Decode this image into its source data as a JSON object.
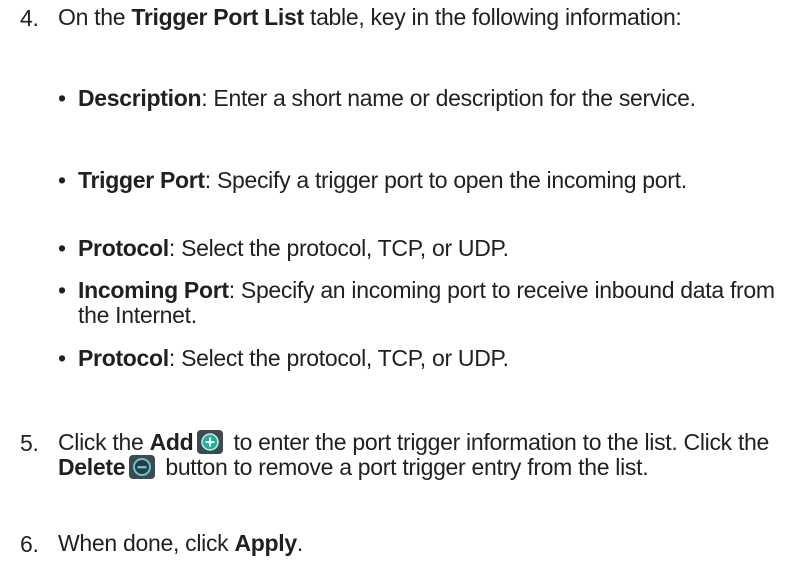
{
  "steps": [
    {
      "number": "4.",
      "prefix": "On the ",
      "bold": "Trigger Port List",
      "suffix": " table, key in the following information:"
    },
    {
      "number": "5.",
      "text_a": "Click the ",
      "bold_a": "Add",
      "text_b": " to enter the port trigger information to the list. Click the ",
      "bold_b": "Delete",
      "text_c": " button to remove a port trigger entry from the list."
    },
    {
      "number": "6.",
      "prefix": "When done, click ",
      "bold": "Apply",
      "suffix": "."
    }
  ],
  "bullets": [
    {
      "term": "Description",
      "text": ": Enter a short name or description for the service."
    },
    {
      "term": "Trigger Port",
      "text": ": Specify a trigger port to open the incoming port."
    },
    {
      "term": "Protocol",
      "text": ": Select the protocol, TCP, or UDP."
    },
    {
      "term": "Incoming Port",
      "text": ": Specify an incoming port to receive inbound data from the Internet."
    },
    {
      "term": "Protocol",
      "text": ": Select the protocol, TCP, or UDP."
    }
  ],
  "bullet_glyph": "•",
  "icons": {
    "add": "add-circle-icon",
    "delete": "delete-circle-icon"
  },
  "colors": {
    "text": "#231f20",
    "add_icon_bg": "#3d4a50",
    "add_icon_fg": "#19b3a0",
    "delete_icon_fg": "#5fc8d6"
  }
}
